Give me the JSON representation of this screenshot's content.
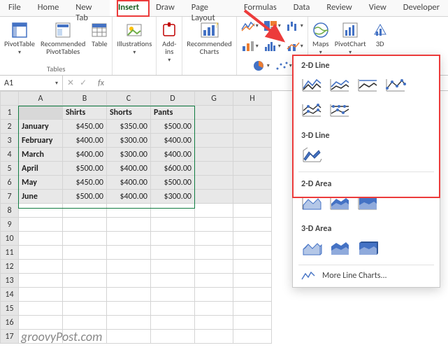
{
  "tabs": {
    "file": "File",
    "home": "Home",
    "new": "New Tab",
    "insert": "Insert",
    "draw": "Draw",
    "page": "Page Layout",
    "formulas": "Formulas",
    "data": "Data",
    "review": "Review",
    "view": "View",
    "developer": "Developer"
  },
  "ribbon": {
    "pivot": "PivotTable",
    "recpivot": "Recommended\nPivotTables",
    "table": "Table",
    "group_tables": "Tables",
    "illus": "Illustrations",
    "addins": "Add-\nins",
    "reccharts": "Recommended\nCharts",
    "maps": "Maps",
    "pivotchart": "PivotChart",
    "threed": "3D"
  },
  "namebox": "A1",
  "columns": [
    "A",
    "B",
    "C",
    "D",
    "G",
    "H"
  ],
  "headers": {
    "b": "Shirts",
    "c": "Shorts",
    "d": "Pants"
  },
  "rows": [
    {
      "m": "January",
      "b": "$450.00",
      "c": "$350.00",
      "d": "$500.00"
    },
    {
      "m": "February",
      "b": "$400.00",
      "c": "$300.00",
      "d": "$400.00"
    },
    {
      "m": "March",
      "b": "$400.00",
      "c": "$300.00",
      "d": "$400.00"
    },
    {
      "m": "April",
      "b": "$500.00",
      "c": "$400.00",
      "d": "$600.00"
    },
    {
      "m": "May",
      "b": "$450.00",
      "c": "$400.00",
      "d": "$500.00"
    },
    {
      "m": "June",
      "b": "$500.00",
      "c": "$400.00",
      "d": "$300.00"
    }
  ],
  "panel": {
    "line2d": "2-D Line",
    "line3d": "3-D Line",
    "area2d": "2-D Area",
    "area3d": "3-D Area",
    "more": "More Line Charts..."
  },
  "watermark": "groovyPost.com",
  "chart_data": {
    "type": "table",
    "categories": [
      "January",
      "February",
      "March",
      "April",
      "May",
      "June"
    ],
    "series": [
      {
        "name": "Shirts",
        "values": [
          450,
          400,
          400,
          500,
          450,
          500
        ]
      },
      {
        "name": "Shorts",
        "values": [
          350,
          300,
          300,
          400,
          400,
          400
        ]
      },
      {
        "name": "Pants",
        "values": [
          500,
          400,
          400,
          600,
          500,
          300
        ]
      }
    ],
    "title": "",
    "xlabel": "",
    "ylabel": ""
  }
}
